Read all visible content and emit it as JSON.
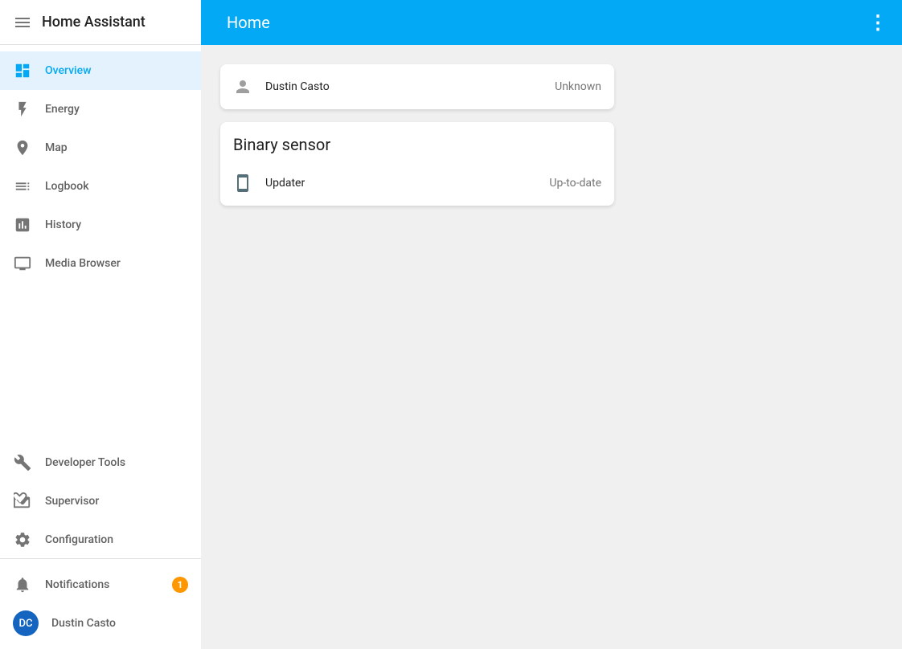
{
  "app": {
    "title": "Home Assistant",
    "page_title": "Home",
    "menu_dots_label": "⋮",
    "menu_icon_label": "☰"
  },
  "sidebar": {
    "app_title": "Home Assistant",
    "items": [
      {
        "id": "overview",
        "label": "Overview",
        "icon": "grid",
        "active": true
      },
      {
        "id": "energy",
        "label": "Energy",
        "icon": "bolt",
        "active": false
      },
      {
        "id": "map",
        "label": "Map",
        "icon": "map",
        "active": false
      },
      {
        "id": "logbook",
        "label": "Logbook",
        "icon": "logbook",
        "active": false
      },
      {
        "id": "history",
        "label": "History",
        "icon": "history",
        "active": false
      },
      {
        "id": "media-browser",
        "label": "Media Browser",
        "icon": "media",
        "active": false
      }
    ],
    "bottom_items": [
      {
        "id": "developer-tools",
        "label": "Developer Tools",
        "icon": "tools"
      },
      {
        "id": "supervisor",
        "label": "Supervisor",
        "icon": "supervisor"
      },
      {
        "id": "configuration",
        "label": "Configuration",
        "icon": "config"
      }
    ],
    "notifications": {
      "label": "Notifications",
      "badge": "1"
    },
    "user": {
      "label": "Dustin Casto",
      "initials": "DC"
    }
  },
  "main": {
    "person_card": {
      "name": "Dustin Casto",
      "status": "Unknown"
    },
    "binary_sensor_card": {
      "title": "Binary sensor",
      "items": [
        {
          "name": "Updater",
          "status": "Up-to-date"
        }
      ]
    }
  }
}
